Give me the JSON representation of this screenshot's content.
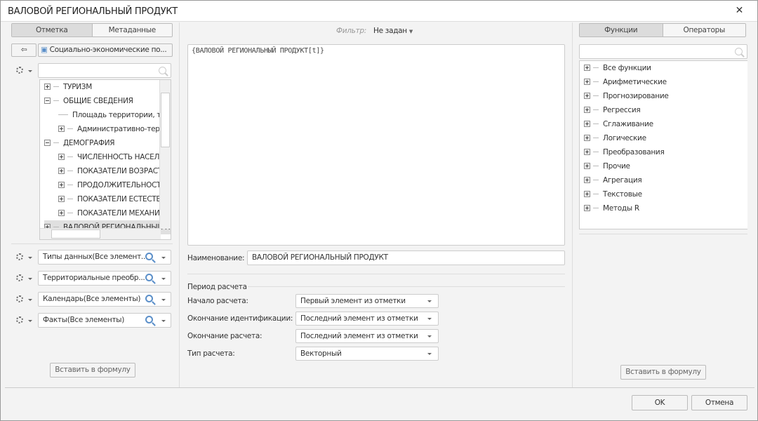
{
  "window": {
    "title": "ВАЛОВОЙ РЕГИОНАЛЬНЫЙ ПРОДУКТ",
    "close_icon": "close-icon"
  },
  "left": {
    "tabs": [
      "Отметка",
      "Метаданные"
    ],
    "source_label": "Социально-экономические по...",
    "search_placeholder": "",
    "tree": [
      {
        "label": "ТУРИЗМ",
        "level": 0,
        "state": "collapsed"
      },
      {
        "label": "ОБЩИЕ СВЕДЕНИЯ",
        "level": 0,
        "state": "expanded"
      },
      {
        "label": "Площадь территории, ты",
        "level": 1,
        "state": "leaf"
      },
      {
        "label": "Административно-терри",
        "level": 1,
        "state": "collapsed"
      },
      {
        "label": "ДЕМОГРАФИЯ",
        "level": 0,
        "state": "expanded"
      },
      {
        "label": "ЧИСЛЕННОСТЬ НАСЕЛЕН",
        "level": 1,
        "state": "collapsed"
      },
      {
        "label": "ПОКАЗАТЕЛИ ВОЗРАСТН",
        "level": 1,
        "state": "collapsed"
      },
      {
        "label": "ПРОДОЛЖИТЕЛЬНОСТЬ",
        "level": 1,
        "state": "collapsed"
      },
      {
        "label": "ПОКАЗАТЕЛИ ЕСТЕСТВЕН",
        "level": 1,
        "state": "collapsed"
      },
      {
        "label": "ПОКАЗАТЕЛИ МЕХАНИЧЕ",
        "level": 1,
        "state": "collapsed"
      },
      {
        "label": "ВАЛОВОЙ РЕГИОНАЛЬНЫЙ П",
        "level": 0,
        "state": "collapsed",
        "selected": true
      }
    ],
    "dimensions": [
      "Типы данных(Все элемент...",
      "Территориальные преобр...",
      "Календарь(Все элементы)",
      "Факты(Все элементы)"
    ],
    "insert_button": "Вставить в формулу"
  },
  "center": {
    "filter_label": "Фильтр:",
    "filter_value": "Не задан",
    "formula": "{ВАЛОВОЙ РЕГИОНАЛЬНЫЙ ПРОДУКТ[t]}",
    "name_label": "Наименование:",
    "name_value": "ВАЛОВОЙ РЕГИОНАЛЬНЫЙ ПРОДУКТ",
    "period_title": "Период расчета",
    "fields": [
      {
        "label": "Начало расчета:",
        "value": "Первый элемент из отметки"
      },
      {
        "label": "Окончание идентификации:",
        "value": "Последний элемент из отметки"
      },
      {
        "label": "Окончание расчета:",
        "value": "Последний элемент из отметки"
      },
      {
        "label": "Тип расчета:",
        "value": "Векторный"
      }
    ]
  },
  "right": {
    "tabs": [
      "Функции",
      "Операторы"
    ],
    "tree": [
      "Все функции",
      "Арифметические",
      "Прогнозирование",
      "Регрессия",
      "Сглаживание",
      "Логические",
      "Преобразования",
      "Прочие",
      "Агрегация",
      "Текстовые",
      "Методы R"
    ],
    "insert_button": "Вставить в формулу"
  },
  "footer": {
    "ok": "OK",
    "cancel": "Отмена"
  }
}
